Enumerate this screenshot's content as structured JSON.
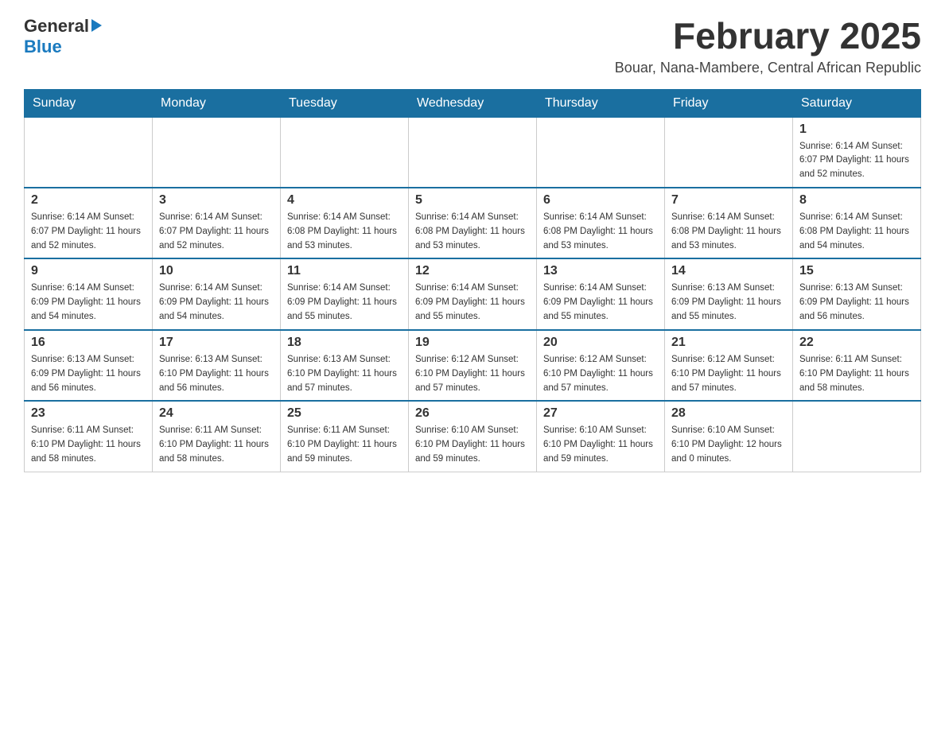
{
  "logo": {
    "general": "General",
    "blue": "Blue"
  },
  "header": {
    "title": "February 2025",
    "subtitle": "Bouar, Nana-Mambere, Central African Republic"
  },
  "weekdays": [
    "Sunday",
    "Monday",
    "Tuesday",
    "Wednesday",
    "Thursday",
    "Friday",
    "Saturday"
  ],
  "weeks": [
    [
      {
        "day": "",
        "info": ""
      },
      {
        "day": "",
        "info": ""
      },
      {
        "day": "",
        "info": ""
      },
      {
        "day": "",
        "info": ""
      },
      {
        "day": "",
        "info": ""
      },
      {
        "day": "",
        "info": ""
      },
      {
        "day": "1",
        "info": "Sunrise: 6:14 AM\nSunset: 6:07 PM\nDaylight: 11 hours\nand 52 minutes."
      }
    ],
    [
      {
        "day": "2",
        "info": "Sunrise: 6:14 AM\nSunset: 6:07 PM\nDaylight: 11 hours\nand 52 minutes."
      },
      {
        "day": "3",
        "info": "Sunrise: 6:14 AM\nSunset: 6:07 PM\nDaylight: 11 hours\nand 52 minutes."
      },
      {
        "day": "4",
        "info": "Sunrise: 6:14 AM\nSunset: 6:08 PM\nDaylight: 11 hours\nand 53 minutes."
      },
      {
        "day": "5",
        "info": "Sunrise: 6:14 AM\nSunset: 6:08 PM\nDaylight: 11 hours\nand 53 minutes."
      },
      {
        "day": "6",
        "info": "Sunrise: 6:14 AM\nSunset: 6:08 PM\nDaylight: 11 hours\nand 53 minutes."
      },
      {
        "day": "7",
        "info": "Sunrise: 6:14 AM\nSunset: 6:08 PM\nDaylight: 11 hours\nand 53 minutes."
      },
      {
        "day": "8",
        "info": "Sunrise: 6:14 AM\nSunset: 6:08 PM\nDaylight: 11 hours\nand 54 minutes."
      }
    ],
    [
      {
        "day": "9",
        "info": "Sunrise: 6:14 AM\nSunset: 6:09 PM\nDaylight: 11 hours\nand 54 minutes."
      },
      {
        "day": "10",
        "info": "Sunrise: 6:14 AM\nSunset: 6:09 PM\nDaylight: 11 hours\nand 54 minutes."
      },
      {
        "day": "11",
        "info": "Sunrise: 6:14 AM\nSunset: 6:09 PM\nDaylight: 11 hours\nand 55 minutes."
      },
      {
        "day": "12",
        "info": "Sunrise: 6:14 AM\nSunset: 6:09 PM\nDaylight: 11 hours\nand 55 minutes."
      },
      {
        "day": "13",
        "info": "Sunrise: 6:14 AM\nSunset: 6:09 PM\nDaylight: 11 hours\nand 55 minutes."
      },
      {
        "day": "14",
        "info": "Sunrise: 6:13 AM\nSunset: 6:09 PM\nDaylight: 11 hours\nand 55 minutes."
      },
      {
        "day": "15",
        "info": "Sunrise: 6:13 AM\nSunset: 6:09 PM\nDaylight: 11 hours\nand 56 minutes."
      }
    ],
    [
      {
        "day": "16",
        "info": "Sunrise: 6:13 AM\nSunset: 6:09 PM\nDaylight: 11 hours\nand 56 minutes."
      },
      {
        "day": "17",
        "info": "Sunrise: 6:13 AM\nSunset: 6:10 PM\nDaylight: 11 hours\nand 56 minutes."
      },
      {
        "day": "18",
        "info": "Sunrise: 6:13 AM\nSunset: 6:10 PM\nDaylight: 11 hours\nand 57 minutes."
      },
      {
        "day": "19",
        "info": "Sunrise: 6:12 AM\nSunset: 6:10 PM\nDaylight: 11 hours\nand 57 minutes."
      },
      {
        "day": "20",
        "info": "Sunrise: 6:12 AM\nSunset: 6:10 PM\nDaylight: 11 hours\nand 57 minutes."
      },
      {
        "day": "21",
        "info": "Sunrise: 6:12 AM\nSunset: 6:10 PM\nDaylight: 11 hours\nand 57 minutes."
      },
      {
        "day": "22",
        "info": "Sunrise: 6:11 AM\nSunset: 6:10 PM\nDaylight: 11 hours\nand 58 minutes."
      }
    ],
    [
      {
        "day": "23",
        "info": "Sunrise: 6:11 AM\nSunset: 6:10 PM\nDaylight: 11 hours\nand 58 minutes."
      },
      {
        "day": "24",
        "info": "Sunrise: 6:11 AM\nSunset: 6:10 PM\nDaylight: 11 hours\nand 58 minutes."
      },
      {
        "day": "25",
        "info": "Sunrise: 6:11 AM\nSunset: 6:10 PM\nDaylight: 11 hours\nand 59 minutes."
      },
      {
        "day": "26",
        "info": "Sunrise: 6:10 AM\nSunset: 6:10 PM\nDaylight: 11 hours\nand 59 minutes."
      },
      {
        "day": "27",
        "info": "Sunrise: 6:10 AM\nSunset: 6:10 PM\nDaylight: 11 hours\nand 59 minutes."
      },
      {
        "day": "28",
        "info": "Sunrise: 6:10 AM\nSunset: 6:10 PM\nDaylight: 12 hours\nand 0 minutes."
      },
      {
        "day": "",
        "info": ""
      }
    ]
  ]
}
